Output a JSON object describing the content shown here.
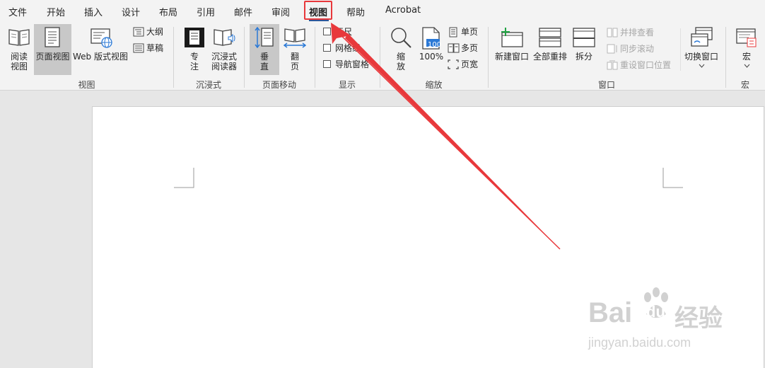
{
  "tabs": [
    {
      "label": "文件"
    },
    {
      "label": "开始"
    },
    {
      "label": "插入"
    },
    {
      "label": "设计"
    },
    {
      "label": "布局"
    },
    {
      "label": "引用"
    },
    {
      "label": "邮件"
    },
    {
      "label": "审阅"
    },
    {
      "label": "视图",
      "active": true
    },
    {
      "label": "帮助"
    },
    {
      "label": "Acrobat"
    }
  ],
  "groups": {
    "views": {
      "label": "视图",
      "read_mode": [
        "阅读",
        "视图"
      ],
      "print_layout": "页面视图",
      "web_layout": "Web 版式视图",
      "outline": "大纲",
      "draft": "草稿"
    },
    "immersive": {
      "label": "沉浸式",
      "focus": [
        "专",
        "注"
      ],
      "immersive_reader": [
        "沉浸式",
        "阅读器"
      ]
    },
    "page_movement": {
      "label": "页面移动",
      "vertical": [
        "垂",
        "直"
      ],
      "side_to_side": [
        "翻",
        "页"
      ]
    },
    "show": {
      "label": "显示",
      "ruler": "标尺",
      "gridlines": "网格线",
      "nav_pane": "导航窗格"
    },
    "zoom": {
      "label": "缩放",
      "zoom": [
        "缩",
        "放"
      ],
      "hundred": "100%",
      "hundred_icon": "100",
      "one_page": "单页",
      "multi_page": "多页",
      "page_width": "页宽"
    },
    "window": {
      "label": "窗口",
      "new_window": "新建窗口",
      "arrange_all": "全部重排",
      "split": "拆分",
      "side_by_side": "并排查看",
      "sync_scroll": "同步滚动",
      "reset_position": "重设窗口位置",
      "switch_windows": "切换窗口"
    },
    "macros": {
      "label": "宏",
      "macros": "宏"
    }
  },
  "watermark": {
    "brand_left": "Bai",
    "brand_mid": "du",
    "brand_right": "经验",
    "url": "jingyan.baidu.com"
  },
  "colors": {
    "accent": "#2b579a",
    "annotation": "#e8383b",
    "ribbon_bg": "#f3f3f3",
    "canvas_bg": "#e6e6e6"
  }
}
